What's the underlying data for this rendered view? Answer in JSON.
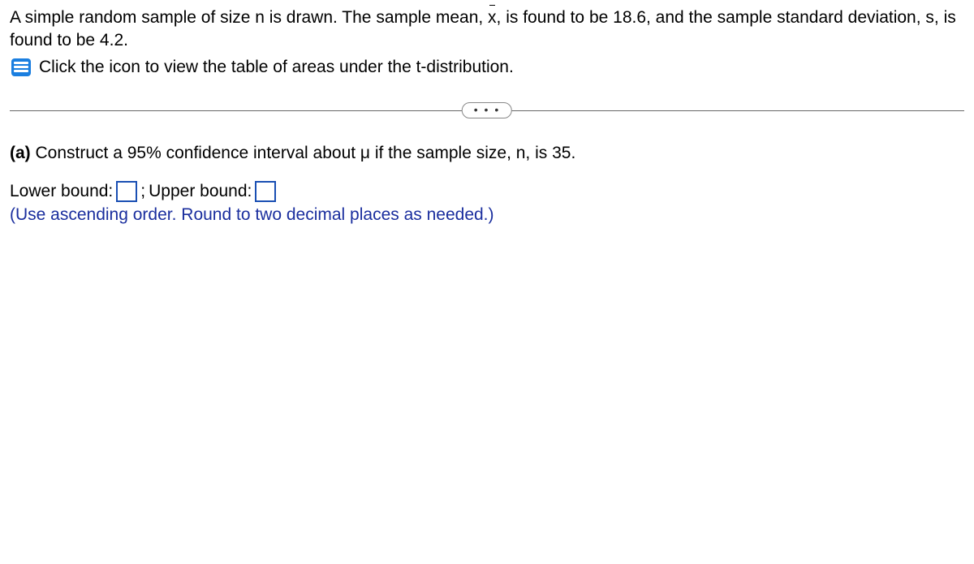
{
  "problem": {
    "line1_before_xbar": "A simple random sample of size n is drawn. The sample mean, ",
    "xbar": "x",
    "line1_after_xbar": ", is found to be 18.6, and the sample standard deviation, s, is found to be 4.2."
  },
  "icon_text": "Click the icon to view the table of areas under the t-distribution.",
  "ellipsis": "• • •",
  "part_a": {
    "label": "(a)",
    "text": " Construct a 95% confidence interval about μ if the sample size, n, is 35."
  },
  "answers": {
    "lower_label": "Lower bound: ",
    "semicolon": "; ",
    "upper_label": "Upper bound: "
  },
  "instruction": "(Use ascending order. Round to two decimal places as needed.)"
}
